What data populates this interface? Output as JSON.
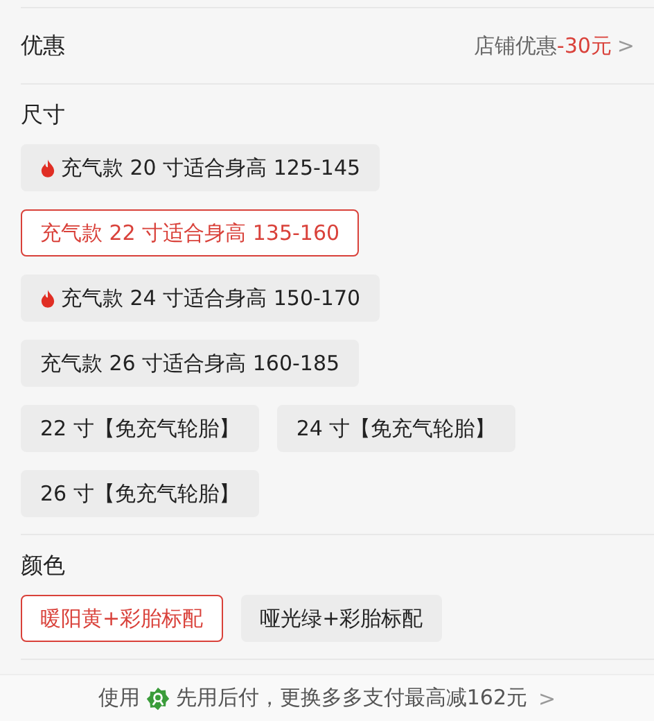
{
  "discount": {
    "label": "优惠",
    "prefix": "店铺优惠",
    "amount": "-30元",
    "chevron": ">"
  },
  "sections": [
    {
      "title": "尺寸",
      "options": [
        {
          "label": "充气款 20 寸适合身高 125-145",
          "hot": true,
          "selected": false
        },
        {
          "label": "充气款 22 寸适合身高 135-160",
          "hot": false,
          "selected": true
        },
        {
          "label": "充气款 24 寸适合身高 150-170",
          "hot": true,
          "selected": false
        },
        {
          "label": "充气款 26 寸适合身高 160-185",
          "hot": false,
          "selected": false
        },
        {
          "label": "22 寸【免充气轮胎】",
          "hot": false,
          "selected": false
        },
        {
          "label": "24 寸【免充气轮胎】",
          "hot": false,
          "selected": false
        },
        {
          "label": "26 寸【免充气轮胎】",
          "hot": false,
          "selected": false
        }
      ]
    },
    {
      "title": "颜色",
      "options": [
        {
          "label": "暖阳黄+彩胎标配",
          "hot": false,
          "selected": true
        },
        {
          "label": "哑光绿+彩胎标配",
          "hot": false,
          "selected": false
        }
      ]
    }
  ],
  "footer": {
    "before": "使用",
    "text": "先用后付，更换多多支付最高减162元",
    "chevron": ">"
  }
}
